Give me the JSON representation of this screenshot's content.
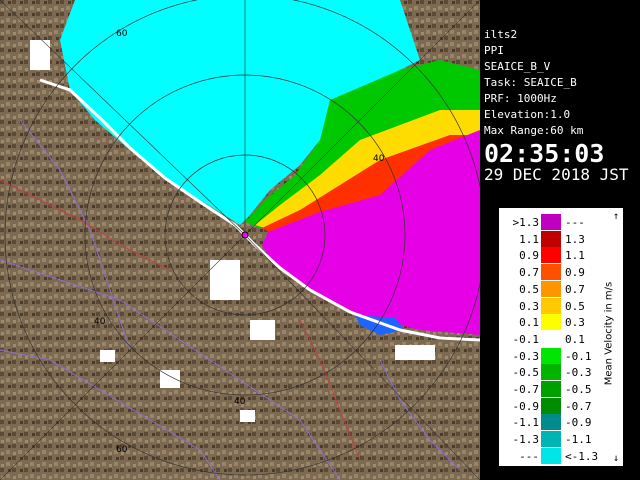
{
  "station": "ilts2",
  "scan_type": "PPI",
  "product": "SEAICE_B_V",
  "task": "Task: SEAICE_B",
  "prf": "PRF: 1000Hz",
  "elevation": "Elevation:1.0",
  "max_range": "Max Range:60 km",
  "time": "02:35:03",
  "date": "29 DEC 2018 JST",
  "range_labels": {
    "r60_top": "60",
    "r60_bottom": "60",
    "r40_east": "40",
    "r40_west": "40",
    "r40_south": "40"
  },
  "legend": {
    "title": "Mean Velocity in m/s",
    "rows": [
      {
        "low": ">1.3",
        "high": "---",
        "color": "#c000c0"
      },
      {
        "low": "1.1",
        "high": "1.3",
        "color": "#c00000"
      },
      {
        "low": "0.9",
        "high": "1.1",
        "color": "#ff0000"
      },
      {
        "low": "0.7",
        "high": "0.9",
        "color": "#ff5000"
      },
      {
        "low": "0.5",
        "high": "0.7",
        "color": "#ff9600"
      },
      {
        "low": "0.3",
        "high": "0.5",
        "color": "#ffc800"
      },
      {
        "low": "0.1",
        "high": "0.3",
        "color": "#ffff00"
      },
      {
        "low": "-0.1",
        "high": "0.1",
        "color": "#ffffff"
      },
      {
        "low": "-0.3",
        "high": "-0.1",
        "color": "#00e600"
      },
      {
        "low": "-0.5",
        "high": "-0.3",
        "color": "#00b400"
      },
      {
        "low": "-0.7",
        "high": "-0.5",
        "color": "#00a000"
      },
      {
        "low": "-0.9",
        "high": "-0.7",
        "color": "#008c00"
      },
      {
        "low": "-1.1",
        "high": "-0.9",
        "color": "#008c8c"
      },
      {
        "low": "-1.3",
        "high": "-1.1",
        "color": "#00b4b4"
      },
      {
        "low": "---",
        "high": "<-1.3",
        "color": "#00e6e6"
      }
    ]
  },
  "colors": {
    "sea_ice_approach": "#00ffff",
    "recede": "#e600e6",
    "land": "#7d6a52",
    "panel_bg": "#000000"
  }
}
